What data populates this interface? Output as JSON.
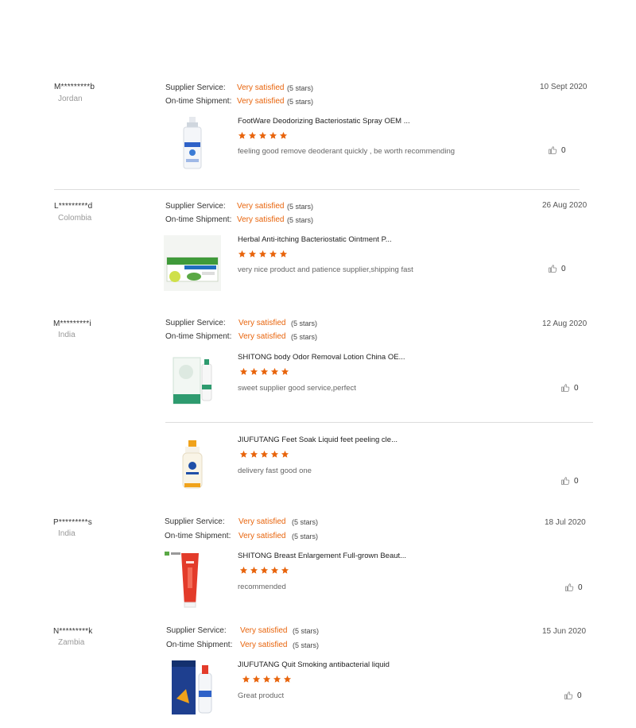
{
  "labels": {
    "supplier_service": "Supplier Service:",
    "ontime_shipment": "On-time Shipment:",
    "rating_text": "Very satisfied",
    "stars_text": "(5 stars)"
  },
  "colors": {
    "accent": "#e8640c",
    "divider": "#dddddd"
  },
  "icons": {
    "like": "thumbs-up-icon",
    "star": "star-icon"
  },
  "reviews": [
    {
      "user": "M*********b",
      "country": "Jordan",
      "date": "10 Sept 2020",
      "products": [
        {
          "title": "FootWare Deodorizing Bacteriostatic Spray OEM ...",
          "rating": 5,
          "comment": "feeling good remove deoderant quickly , be worth recommending",
          "likes": "0"
        }
      ]
    },
    {
      "user": "L*********d",
      "country": "Colombia",
      "date": "26 Aug 2020",
      "products": [
        {
          "title": "Herbal Anti-itching Bacteriostatic Ointment P...",
          "rating": 5,
          "comment": "very nice product and patience supplier,shipping fast",
          "likes": "0"
        }
      ]
    },
    {
      "user": "M*********i",
      "country": "India",
      "date": "12 Aug 2020",
      "products": [
        {
          "title": "SHITONG body Odor Removal Lotion China OE...",
          "rating": 5,
          "comment": "sweet supplier good service,perfect",
          "likes": "0"
        },
        {
          "title": "JIUFUTANG Feet Soak Liquid feet peeling cle...",
          "rating": 5,
          "comment": "delivery fast good one",
          "likes": "0"
        }
      ]
    },
    {
      "user": "P*********s",
      "country": "India",
      "date": "18 Jul 2020",
      "products": [
        {
          "title": "SHITONG Breast Enlargement Full-grown Beaut...",
          "rating": 5,
          "comment": "recommended",
          "likes": "0"
        }
      ]
    },
    {
      "user": "N*********k",
      "country": "Zambia",
      "date": "15 Jun 2020",
      "products": [
        {
          "title": "JIUFUTANG Quit Smoking antibacterial liquid",
          "rating": 5,
          "comment": "Great product",
          "likes": "0"
        }
      ]
    }
  ]
}
